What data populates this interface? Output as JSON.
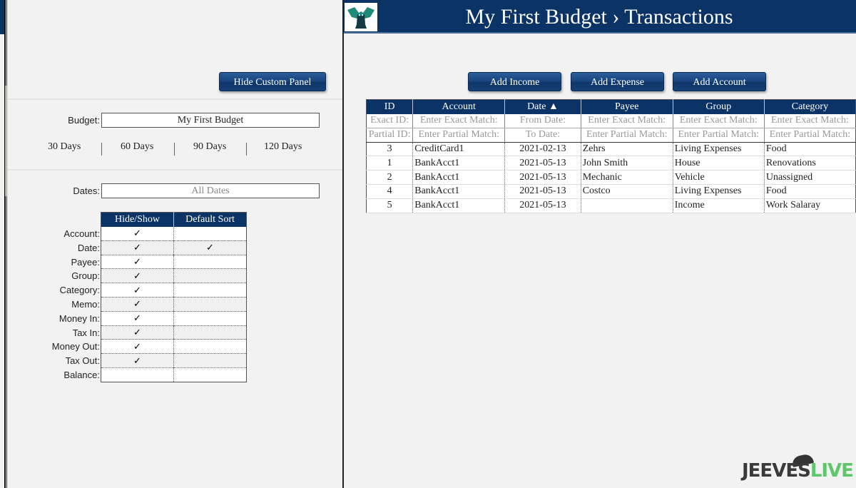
{
  "header": {
    "title": "My First Budget › Transactions",
    "logo": "owl-logo-icon"
  },
  "custom_panel": {
    "hide_button": "Hide Custom Panel",
    "budget_label": "Budget:",
    "budget_value": "My First Budget",
    "day_ranges": [
      "30 Days",
      "60 Days",
      "90 Days",
      "120 Days"
    ],
    "dates_label": "Dates:",
    "dates_placeholder": "All Dates",
    "column_table": {
      "headers": [
        "Hide/Show",
        "Default Sort"
      ],
      "rows": [
        {
          "label": "Account:",
          "show": "✓",
          "sort": ""
        },
        {
          "label": "Date:",
          "show": "✓",
          "sort": "✓"
        },
        {
          "label": "Payee:",
          "show": "✓",
          "sort": ""
        },
        {
          "label": "Group:",
          "show": "✓",
          "sort": ""
        },
        {
          "label": "Category:",
          "show": "✓",
          "sort": ""
        },
        {
          "label": "Memo:",
          "show": "✓",
          "sort": ""
        },
        {
          "label": "Money In:",
          "show": "✓",
          "sort": ""
        },
        {
          "label": "Tax In:",
          "show": "✓",
          "sort": ""
        },
        {
          "label": "Money Out:",
          "show": "✓",
          "sort": ""
        },
        {
          "label": "Tax Out:",
          "show": "✓",
          "sort": ""
        },
        {
          "label": "Balance:",
          "show": "",
          "sort": ""
        }
      ]
    }
  },
  "toolbar": {
    "add_income": "Add Income",
    "add_expense": "Add Expense",
    "add_account": "Add Account"
  },
  "transactions": {
    "columns": [
      "ID",
      "Account",
      "Date ▲",
      "Payee",
      "Group",
      "Category"
    ],
    "exact_filter": [
      "Exact ID:",
      "Enter Exact Match:",
      "From Date:",
      "Enter Exact Match:",
      "Enter Exact Match:",
      "Enter Exact Match:"
    ],
    "partial_filter": [
      "Partial ID:",
      "Enter Partial Match:",
      "To Date:",
      "Enter Partial Match:",
      "Enter Partial Match:",
      "Enter Partial Match:"
    ],
    "rows": [
      [
        "3",
        "CreditCard1",
        "2021-02-13",
        "Zehrs",
        "Living Expenses",
        "Food"
      ],
      [
        "1",
        "BankAcct1",
        "2021-05-13",
        "John Smith",
        "House",
        "Renovations"
      ],
      [
        "2",
        "BankAcct1",
        "2021-05-13",
        "Mechanic",
        "Vehicle",
        "Unassigned"
      ],
      [
        "4",
        "BankAcct1",
        "2021-05-13",
        "Costco",
        "Living Expenses",
        "Food"
      ],
      [
        "5",
        "BankAcct1",
        "2021-05-13",
        "",
        "Income",
        "Work Salaray"
      ]
    ]
  },
  "watermark": {
    "part1": "JEEVES",
    "part2": "LIVE"
  },
  "colors": {
    "navy": "#0c3366",
    "accent_green": "#5ec66b"
  }
}
